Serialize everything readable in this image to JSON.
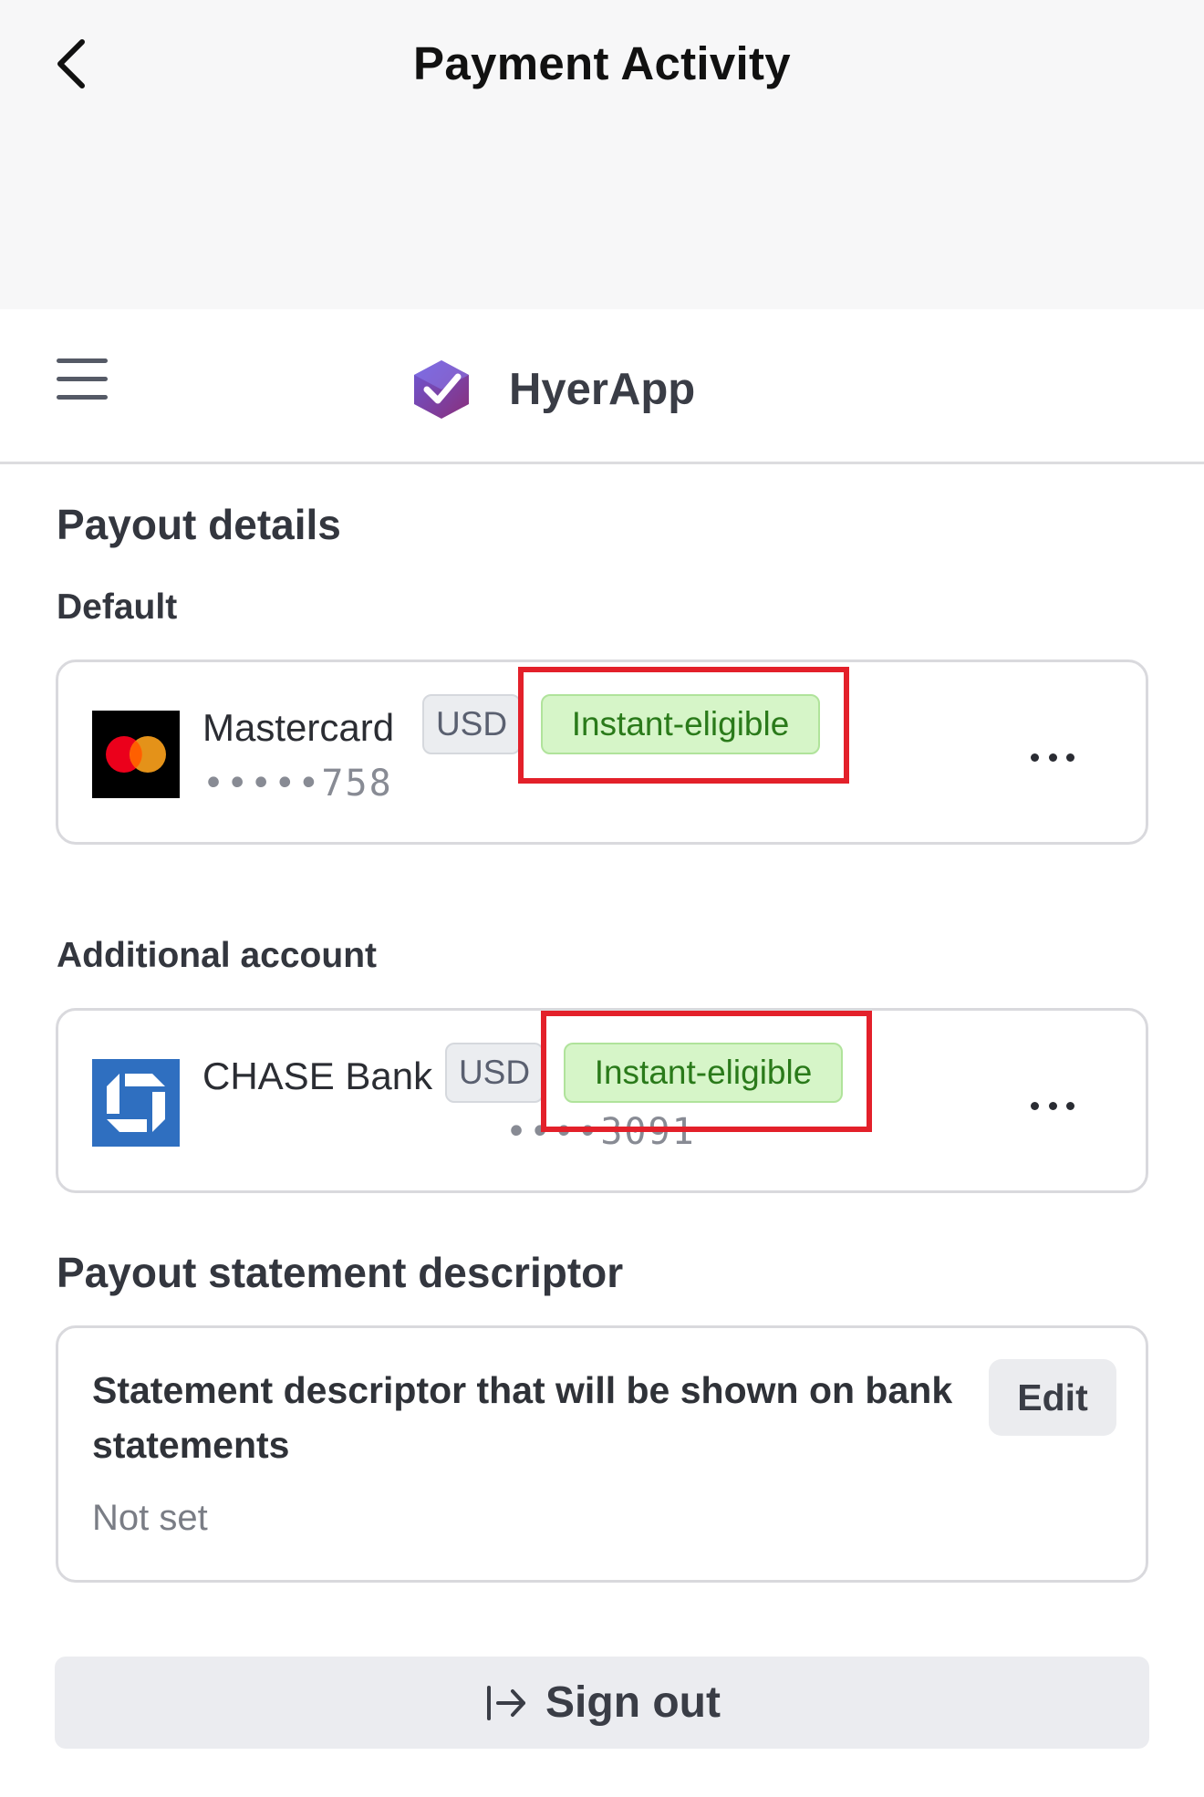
{
  "nav": {
    "title": "Payment Activity",
    "back_icon": "chevron-left-icon"
  },
  "app_bar": {
    "menu_icon": "hamburger-menu-icon",
    "brand_logo_icon": "shield-check-logo-icon",
    "brand_name": "HyerApp"
  },
  "payout": {
    "title": "Payout details",
    "default_label": "Default",
    "default_account": {
      "name": "Mastercard",
      "currency": "USD",
      "badge": "Instant-eligible",
      "masked_number": "•••••758",
      "logo_icon": "mastercard-logo-icon",
      "more_icon": "more-horizontal-icon"
    },
    "additional_label": "Additional account",
    "additional_account": {
      "name": "CHASE Bank",
      "currency": "USD",
      "badge": "Instant-eligible",
      "masked_number": "••••3091",
      "logo_icon": "chase-logo-icon",
      "more_icon": "more-horizontal-icon"
    }
  },
  "descriptor": {
    "title": "Payout statement descriptor",
    "description": "Statement descriptor that will be shown on bank statements",
    "status": "Not set",
    "edit_label": "Edit"
  },
  "footer": {
    "signout_label": "Sign out",
    "signout_icon": "sign-out-icon"
  },
  "colors": {
    "highlight": "#e3202a",
    "instant_badge_bg": "#d6f5c8",
    "instant_badge_text": "#2a7a1a",
    "chase_blue": "#2f6fc0",
    "brand_purple": "#5b3aa8"
  }
}
